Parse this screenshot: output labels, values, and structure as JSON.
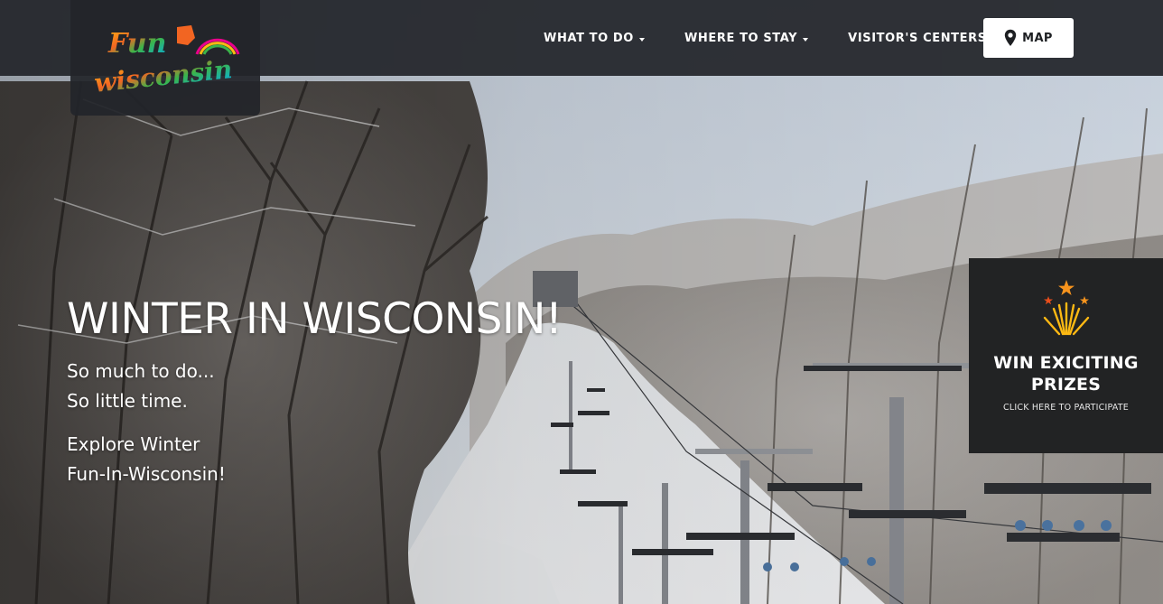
{
  "brand": {
    "logo_line1": "Fun",
    "logo_line2": "wisconsin",
    "logo_colors": [
      "#f26522",
      "#fdb913",
      "#3bb54a",
      "#00aeef",
      "#ec008c"
    ]
  },
  "nav": {
    "items": [
      {
        "label": "WHAT TO DO",
        "icon": "caret-down-icon"
      },
      {
        "label": "WHERE TO STAY",
        "icon": "caret-down-icon"
      },
      {
        "label": "VISITOR'S CENTERS",
        "icon": "caret-down-icon"
      }
    ],
    "map_button": {
      "label": "MAP",
      "icon": "map-pin-icon"
    }
  },
  "hero": {
    "title": "WINTER IN WISCONSIN!",
    "tagline_line1": "So much to do...",
    "tagline_line2": "So little time.",
    "explore_line1": "Explore Winter",
    "explore_line2": "Fun-In-Wisconsin!"
  },
  "prize_panel": {
    "icon": "fireworks-icon",
    "title_line1": "WIN EXICITING",
    "title_line2": "PRIZES",
    "cta": "CLICK HERE TO PARTICIPATE"
  },
  "colors": {
    "navbar_bg": "#22252a",
    "panel_bg": "#222324",
    "text": "#ffffff"
  }
}
